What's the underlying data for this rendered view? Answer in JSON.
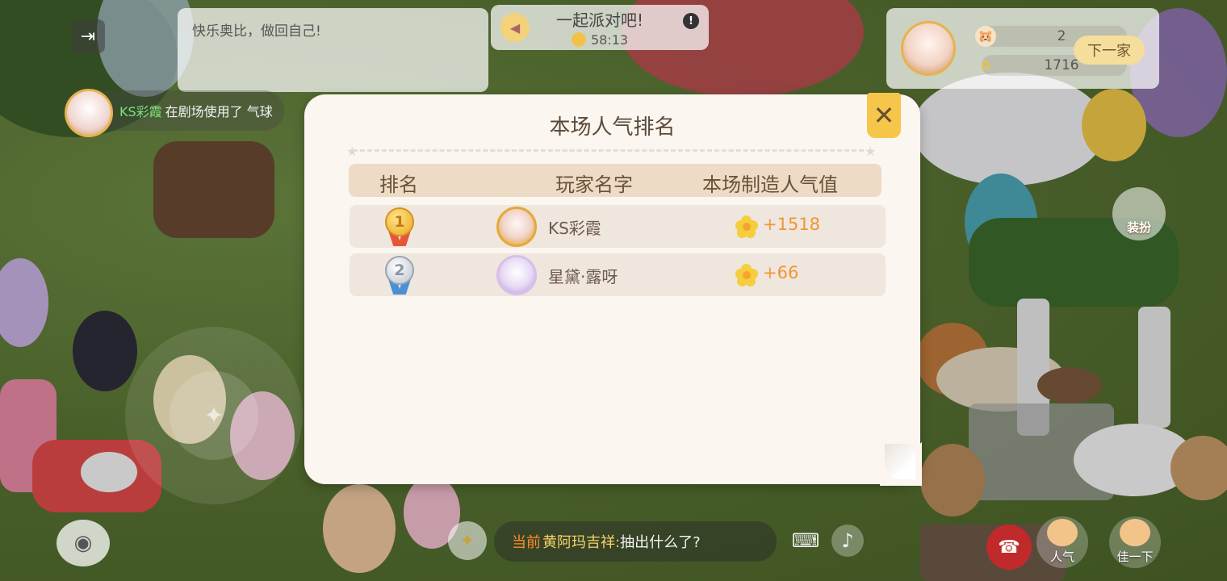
{
  "hud": {
    "chat_message": "快乐奥比，做回自己!",
    "party_title": "一起派对吧!",
    "party_warn": "!",
    "party_timer": "58:13",
    "host_popularity": "2",
    "host_flowers": "1716",
    "next_label": "下一家",
    "notice_name": "KS彩霞",
    "notice_text": "在剧场使用了 气球",
    "dress_label": "装扮",
    "bottom_chat_prefix": "当前",
    "bottom_chat_speaker": "黄阿玛吉祥:",
    "bottom_chat_text": "抽出什么了?",
    "popularity_label": "人气",
    "hit_label": "佳一下"
  },
  "modal": {
    "title": "本场人气排名",
    "close_symbol": "✕",
    "columns": {
      "rank": "排名",
      "name": "玩家名字",
      "score": "本场制造人气值"
    },
    "rows": [
      {
        "rank": "1",
        "name": "KS彩霞",
        "value": "+1518"
      },
      {
        "rank": "2",
        "name": "星黛·露呀",
        "value": "+66"
      }
    ]
  },
  "colors": {
    "modal_bg": "#fbf6f0",
    "header_bg": "#eedbc5",
    "row_bg": "#efe6dd",
    "value_orange": "#ef9638",
    "close_yellow": "#f5c64a"
  }
}
